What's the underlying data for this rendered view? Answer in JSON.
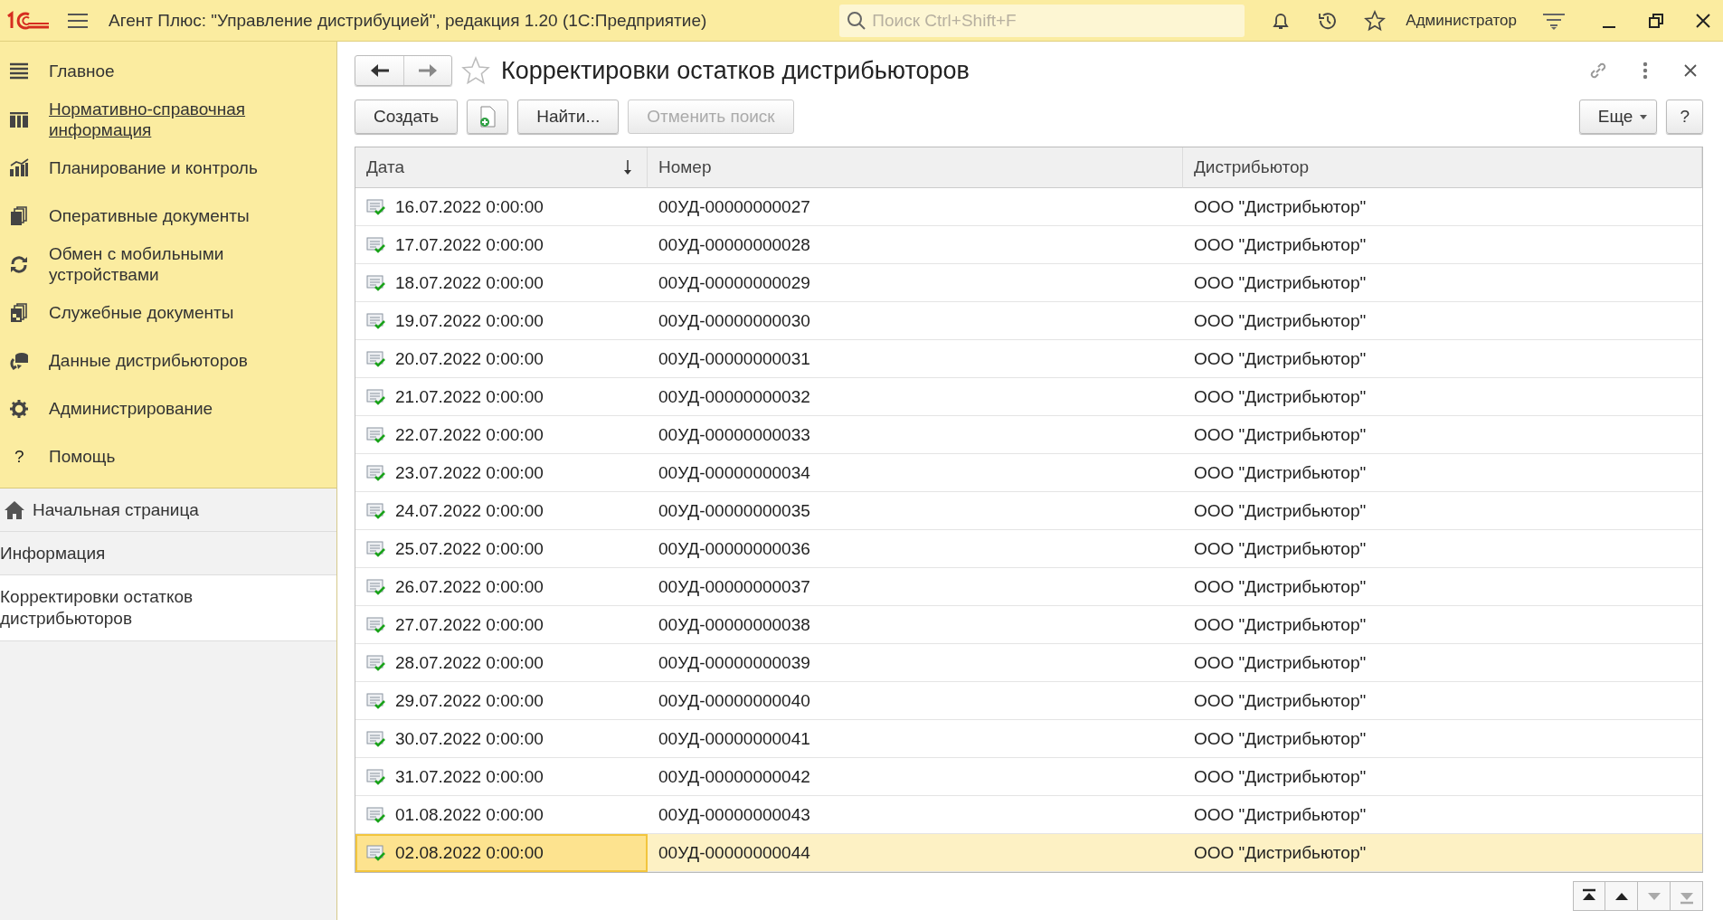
{
  "app": {
    "title": "Агент Плюс: \"Управление дистрибуцией\", редакция 1.20  (1С:Предприятие)",
    "search": {
      "placeholder": "Поиск Ctrl+Shift+F"
    },
    "user": "Администратор"
  },
  "sections": [
    {
      "label": "Главное",
      "kind": "menu",
      "hovered": false
    },
    {
      "label": "Нормативно-справочная информация",
      "kind": "catalog",
      "hovered": true
    },
    {
      "label": "Планирование и контроль",
      "kind": "chart",
      "hovered": false
    },
    {
      "label": "Оперативные документы",
      "kind": "docs",
      "hovered": false
    },
    {
      "label": "Обмен с мобильными устройствами",
      "kind": "sync",
      "hovered": false
    },
    {
      "label": "Служебные документы",
      "kind": "service",
      "hovered": false
    },
    {
      "label": "Данные дистрибьюторов",
      "kind": "data",
      "hovered": false
    },
    {
      "label": "Администрирование",
      "kind": "gear",
      "hovered": false
    },
    {
      "label": "Помощь",
      "kind": "glyph",
      "glyph": "?",
      "hovered": false
    }
  ],
  "open_windows": [
    {
      "label": "Начальная страница",
      "kind": "home",
      "selected": false
    },
    {
      "label": "Информация",
      "kind": "plain",
      "selected": false
    },
    {
      "label": "Корректировки остатков дистрибьюторов",
      "kind": "plain",
      "selected": true
    }
  ],
  "form": {
    "title": "Корректировки остатков дистрибьюторов",
    "favorite": false,
    "toolbar": [
      {
        "kind": "text",
        "label": "Создать",
        "disabled": false
      },
      {
        "kind": "copy",
        "disabled": false
      },
      {
        "kind": "text",
        "label": "Найти...",
        "disabled": false
      },
      {
        "kind": "text",
        "label": "Отменить поиск",
        "disabled": true
      }
    ],
    "more": {
      "label": "Еще"
    },
    "help": {
      "label": "?"
    }
  },
  "table": {
    "columns": [
      {
        "label": "Дата",
        "sorted": true
      },
      {
        "label": "Номер",
        "sorted": false
      },
      {
        "label": "Дистрибьютор",
        "sorted": false
      }
    ],
    "rows": [
      {
        "date": "16.07.2022 0:00:00",
        "number": "00УД-00000000027",
        "distributor": "ООО \"Дистрибьютор\"",
        "selected": false
      },
      {
        "date": "17.07.2022 0:00:00",
        "number": "00УД-00000000028",
        "distributor": "ООО \"Дистрибьютор\"",
        "selected": false
      },
      {
        "date": "18.07.2022 0:00:00",
        "number": "00УД-00000000029",
        "distributor": "ООО \"Дистрибьютор\"",
        "selected": false
      },
      {
        "date": "19.07.2022 0:00:00",
        "number": "00УД-00000000030",
        "distributor": "ООО \"Дистрибьютор\"",
        "selected": false
      },
      {
        "date": "20.07.2022 0:00:00",
        "number": "00УД-00000000031",
        "distributor": "ООО \"Дистрибьютор\"",
        "selected": false
      },
      {
        "date": "21.07.2022 0:00:00",
        "number": "00УД-00000000032",
        "distributor": "ООО \"Дистрибьютор\"",
        "selected": false
      },
      {
        "date": "22.07.2022 0:00:00",
        "number": "00УД-00000000033",
        "distributor": "ООО \"Дистрибьютор\"",
        "selected": false
      },
      {
        "date": "23.07.2022 0:00:00",
        "number": "00УД-00000000034",
        "distributor": "ООО \"Дистрибьютор\"",
        "selected": false
      },
      {
        "date": "24.07.2022 0:00:00",
        "number": "00УД-00000000035",
        "distributor": "ООО \"Дистрибьютор\"",
        "selected": false
      },
      {
        "date": "25.07.2022 0:00:00",
        "number": "00УД-00000000036",
        "distributor": "ООО \"Дистрибьютор\"",
        "selected": false
      },
      {
        "date": "26.07.2022 0:00:00",
        "number": "00УД-00000000037",
        "distributor": "ООО \"Дистрибьютор\"",
        "selected": false
      },
      {
        "date": "27.07.2022 0:00:00",
        "number": "00УД-00000000038",
        "distributor": "ООО \"Дистрибьютор\"",
        "selected": false
      },
      {
        "date": "28.07.2022 0:00:00",
        "number": "00УД-00000000039",
        "distributor": "ООО \"Дистрибьютор\"",
        "selected": false
      },
      {
        "date": "29.07.2022 0:00:00",
        "number": "00УД-00000000040",
        "distributor": "ООО \"Дистрибьютор\"",
        "selected": false
      },
      {
        "date": "30.07.2022 0:00:00",
        "number": "00УД-00000000041",
        "distributor": "ООО \"Дистрибьютор\"",
        "selected": false
      },
      {
        "date": "31.07.2022 0:00:00",
        "number": "00УД-00000000042",
        "distributor": "ООО \"Дистрибьютор\"",
        "selected": false
      },
      {
        "date": "01.08.2022 0:00:00",
        "number": "00УД-00000000043",
        "distributor": "ООО \"Дистрибьютор\"",
        "selected": false
      },
      {
        "date": "02.08.2022 0:00:00",
        "number": "00УД-00000000044",
        "distributor": "ООО \"Дистрибьютор\"",
        "selected": true
      }
    ]
  },
  "scroll_buttons": [
    {
      "kind": "first",
      "disabled": false
    },
    {
      "kind": "up",
      "disabled": false
    },
    {
      "kind": "down",
      "disabled": true
    },
    {
      "kind": "last",
      "disabled": true
    }
  ]
}
